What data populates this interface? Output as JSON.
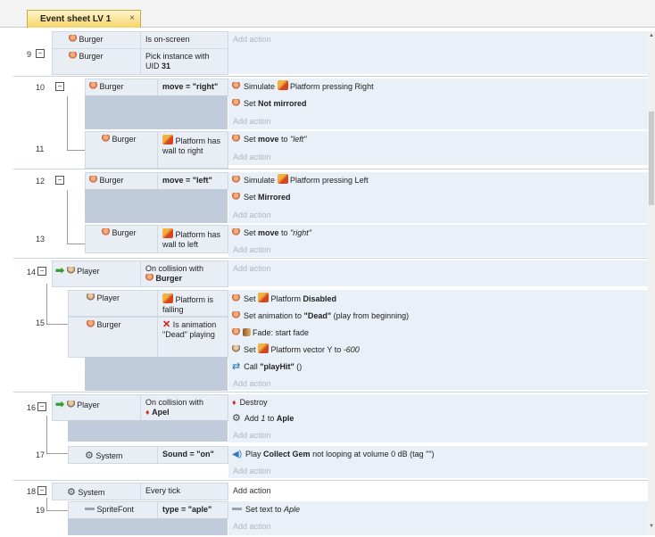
{
  "tab": {
    "title": "Event sheet LV 1",
    "close": "×"
  },
  "scroll": {
    "up": "▲",
    "down": "▼"
  },
  "add_action": "Add action",
  "ev9": {
    "num": "9",
    "toggle": "−",
    "c1_obj": "Burger",
    "c1_text": "Is on-screen",
    "c2_obj": "Burger",
    "c2_text": "Pick instance with",
    "c2_uid_label": "UID ",
    "c2_uid": "31"
  },
  "ev10": {
    "num": "10",
    "toggle": "−",
    "c_obj": "Burger",
    "c_text": "move = \"right\"",
    "a1_pre": "Simulate ",
    "a1_post": " Platform pressing Right",
    "a2_pre": "Set ",
    "a2_bold": "Not mirrored"
  },
  "ev11": {
    "num": "11",
    "c_obj": "Burger",
    "c_text": "Platform has wall to right",
    "a1_pre": "Set ",
    "a1_bold": "move",
    "a1_mid": " to ",
    "a1_ital": "\"left\""
  },
  "ev12": {
    "num": "12",
    "toggle": "−",
    "c_obj": "Burger",
    "c_text": "move = \"left\"",
    "a1_pre": "Simulate ",
    "a1_post": " Platform pressing Left",
    "a2_pre": "Set ",
    "a2_bold": "Mirrored"
  },
  "ev13": {
    "num": "13",
    "c_obj": "Burger",
    "c_text": "Platform has wall to left",
    "a1_pre": "Set ",
    "a1_bold": "move",
    "a1_mid": " to ",
    "a1_ital": "\"right\""
  },
  "ev14": {
    "num": "14",
    "toggle": "−",
    "c_obj": "Player",
    "c_text": "On collision with",
    "c_target": "Burger"
  },
  "ev15": {
    "num": "15",
    "c1_obj": "Player",
    "c1_text": "Platform is falling",
    "c2_obj": "Burger",
    "c2_text": "Is animation \"Dead\" playing",
    "a1_pre": "Set ",
    "a1_mid": " Platform ",
    "a1_bold": "Disabled",
    "a2_pre": "Set animation to ",
    "a2_bold": "\"Dead\"",
    "a2_post": " (play from beginning)",
    "a3_post": " Fade: start fade",
    "a4_pre": "Set ",
    "a4_mid": " Platform vector Y to ",
    "a4_ital": "-600",
    "a5_pre": "Call ",
    "a5_bold": "\"playHit\"",
    "a5_post": " ()"
  },
  "ev16": {
    "num": "16",
    "toggle": "−",
    "c_obj": "Player",
    "c_text": "On collision with",
    "c_target": "Apel",
    "a1": "Destroy",
    "a2_pre": "Add ",
    "a2_ital": "1",
    "a2_mid": " to ",
    "a2_bold": "Aple"
  },
  "ev17": {
    "num": "17",
    "c_obj": "System",
    "c_text": "Sound = \"on\"",
    "a1_pre": "Play ",
    "a1_bold": "Collect Gem",
    "a1_post": " not looping at volume 0 dB (tag \"\")"
  },
  "ev18": {
    "num": "18",
    "toggle": "−",
    "c_obj": "System",
    "c_text": "Every tick",
    "a_add": "Add action"
  },
  "ev19": {
    "num": "19",
    "c_obj": "SpriteFont",
    "c_text": "type = \"aple\"",
    "a1_pre": "Set text to ",
    "a1_ital": "Aple"
  }
}
